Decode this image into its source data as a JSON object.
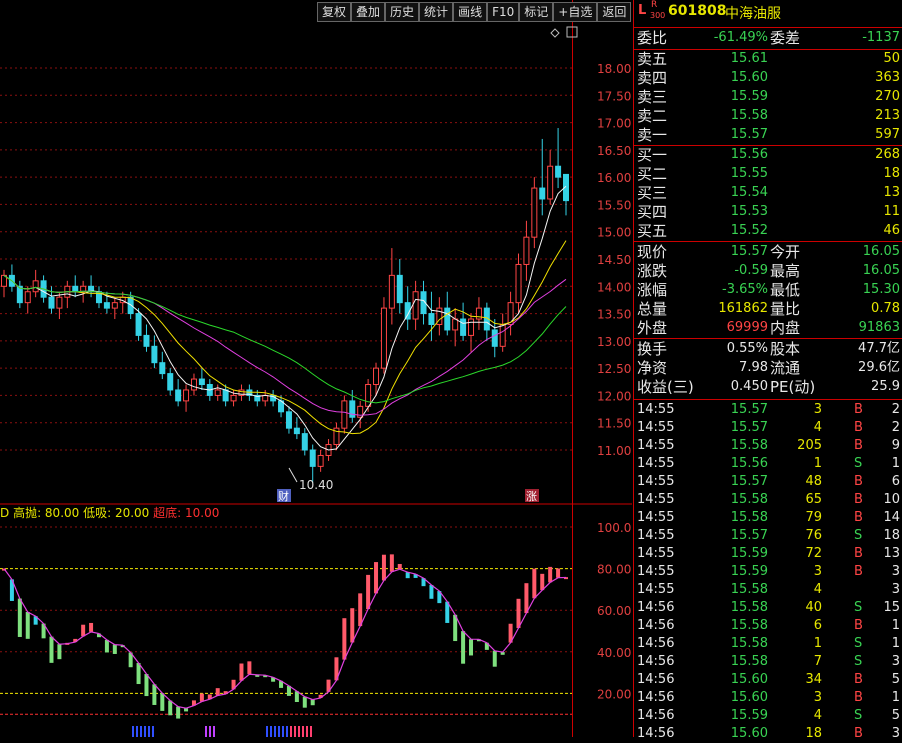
{
  "toolbar": [
    "复权",
    "叠加",
    "历史",
    "统计",
    "画线",
    "F10",
    "标记",
    "+自选",
    "返回"
  ],
  "stock": {
    "badge_l": "L",
    "badge_r": "R",
    "badge_num": "300",
    "code": "601808",
    "name": "中海油服"
  },
  "wei": {
    "bi_label": "委比",
    "bi_value": "-61.49%",
    "cha_label": "委差",
    "cha_value": "-1137"
  },
  "asks": [
    {
      "label": "卖五",
      "price": "15.61",
      "vol": "50"
    },
    {
      "label": "卖四",
      "price": "15.60",
      "vol": "363"
    },
    {
      "label": "卖三",
      "price": "15.59",
      "vol": "270"
    },
    {
      "label": "卖二",
      "price": "15.58",
      "vol": "213"
    },
    {
      "label": "卖一",
      "price": "15.57",
      "vol": "597"
    }
  ],
  "bids": [
    {
      "label": "买一",
      "price": "15.56",
      "vol": "268"
    },
    {
      "label": "买二",
      "price": "15.55",
      "vol": "18"
    },
    {
      "label": "买三",
      "price": "15.54",
      "vol": "13"
    },
    {
      "label": "买四",
      "price": "15.53",
      "vol": "11"
    },
    {
      "label": "买五",
      "price": "15.52",
      "vol": "46"
    }
  ],
  "quote": [
    {
      "l1": "现价",
      "v1": "15.57",
      "c1": "green",
      "l2": "今开",
      "v2": "16.05",
      "c2": "green"
    },
    {
      "l1": "涨跌",
      "v1": "-0.59",
      "c1": "green",
      "l2": "最高",
      "v2": "16.05",
      "c2": "green"
    },
    {
      "l1": "涨幅",
      "v1": "-3.65%",
      "c1": "green",
      "l2": "最低",
      "v2": "15.30",
      "c2": "green"
    },
    {
      "l1": "总量",
      "v1": "161862",
      "c1": "yellow",
      "l2": "量比",
      "v2": "0.78",
      "c2": "yellow"
    },
    {
      "l1": "外盘",
      "v1": "69999",
      "c1": "red",
      "l2": "内盘",
      "v2": "91863",
      "c2": "green"
    }
  ],
  "info": [
    {
      "l1": "换手",
      "v1": "0.55%",
      "l2": "股本",
      "v2": "47.7亿"
    },
    {
      "l1": "净资",
      "v1": "7.98",
      "l2": "流通",
      "v2": "29.6亿"
    },
    {
      "l1": "收益(三)",
      "v1": "0.450",
      "l2": "PE(动)",
      "v2": "25.9"
    }
  ],
  "ticks": [
    {
      "t": "14:55",
      "p": "15.57",
      "v": "3",
      "d": "B",
      "n": "2"
    },
    {
      "t": "14:55",
      "p": "15.57",
      "v": "4",
      "d": "B",
      "n": "2"
    },
    {
      "t": "14:55",
      "p": "15.58",
      "v": "205",
      "d": "B",
      "n": "9"
    },
    {
      "t": "14:55",
      "p": "15.56",
      "v": "1",
      "d": "S",
      "n": "1"
    },
    {
      "t": "14:55",
      "p": "15.57",
      "v": "48",
      "d": "B",
      "n": "6"
    },
    {
      "t": "14:55",
      "p": "15.58",
      "v": "65",
      "d": "B",
      "n": "10"
    },
    {
      "t": "14:55",
      "p": "15.58",
      "v": "79",
      "d": "B",
      "n": "14"
    },
    {
      "t": "14:55",
      "p": "15.57",
      "v": "76",
      "d": "S",
      "n": "18"
    },
    {
      "t": "14:55",
      "p": "15.59",
      "v": "72",
      "d": "B",
      "n": "13"
    },
    {
      "t": "14:55",
      "p": "15.59",
      "v": "3",
      "d": "B",
      "n": "3"
    },
    {
      "t": "14:55",
      "p": "15.58",
      "v": "4",
      "d": "",
      "n": "3"
    },
    {
      "t": "14:56",
      "p": "15.58",
      "v": "40",
      "d": "S",
      "n": "15"
    },
    {
      "t": "14:56",
      "p": "15.58",
      "v": "6",
      "d": "B",
      "n": "1"
    },
    {
      "t": "14:56",
      "p": "15.58",
      "v": "1",
      "d": "S",
      "n": "1"
    },
    {
      "t": "14:56",
      "p": "15.58",
      "v": "7",
      "d": "S",
      "n": "3"
    },
    {
      "t": "14:56",
      "p": "15.60",
      "v": "34",
      "d": "B",
      "n": "5"
    },
    {
      "t": "14:56",
      "p": "15.60",
      "v": "3",
      "d": "B",
      "n": "1"
    },
    {
      "t": "14:56",
      "p": "15.59",
      "v": "4",
      "d": "S",
      "n": "5"
    },
    {
      "t": "14:56",
      "p": "15.60",
      "v": "18",
      "d": "B",
      "n": "3"
    }
  ],
  "indicator": {
    "lead": "D",
    "gao_label": "高抛:",
    "gao": "80.00",
    "di_label": "低吸:",
    "di": "20.00",
    "chao_label": "超底:",
    "chao": "10.00"
  },
  "chart_markers": {
    "low_label": "10.40",
    "cai": "财",
    "zhang": "涨"
  },
  "colors": {
    "up": "#ff4545",
    "down": "#35d2e6",
    "ma5": "#f5f5f5",
    "ma10": "#f0e000",
    "ma20": "#e040e0",
    "ma60": "#2bd82b",
    "grid": "#8a1010"
  },
  "chart_data": [
    {
      "type": "candlestick",
      "y_ticks": [
        18.0,
        17.5,
        17.0,
        16.5,
        16.0,
        15.5,
        15.0,
        14.5,
        14.0,
        13.5,
        13.0,
        12.5,
        12.0,
        11.5,
        11.0
      ],
      "ylim": [
        10.2,
        18.3
      ],
      "candles": [
        [
          14.0,
          14.3,
          13.8,
          14.2
        ],
        [
          14.2,
          14.4,
          13.9,
          14.0
        ],
        [
          14.0,
          14.1,
          13.6,
          13.7
        ],
        [
          13.7,
          14.0,
          13.5,
          13.9
        ],
        [
          13.9,
          14.3,
          13.8,
          14.1
        ],
        [
          14.1,
          14.2,
          13.7,
          13.8
        ],
        [
          13.8,
          14.0,
          13.5,
          13.6
        ],
        [
          13.6,
          13.9,
          13.4,
          13.8
        ],
        [
          13.8,
          14.1,
          13.6,
          14.0
        ],
        [
          14.0,
          14.2,
          13.8,
          13.9
        ],
        [
          13.9,
          14.1,
          13.7,
          14.0
        ],
        [
          14.0,
          14.2,
          13.8,
          13.9
        ],
        [
          13.9,
          14.0,
          13.6,
          13.7
        ],
        [
          13.7,
          13.9,
          13.5,
          13.6
        ],
        [
          13.6,
          13.8,
          13.4,
          13.7
        ],
        [
          13.7,
          13.9,
          13.5,
          13.8
        ],
        [
          13.8,
          13.9,
          13.4,
          13.5
        ],
        [
          13.5,
          13.6,
          13.0,
          13.1
        ],
        [
          13.1,
          13.3,
          12.8,
          12.9
        ],
        [
          12.9,
          13.1,
          12.5,
          12.6
        ],
        [
          12.6,
          12.8,
          12.3,
          12.4
        ],
        [
          12.4,
          12.5,
          12.0,
          12.1
        ],
        [
          12.1,
          12.3,
          11.8,
          11.9
        ],
        [
          11.9,
          12.2,
          11.7,
          12.1
        ],
        [
          12.1,
          12.4,
          12.0,
          12.3
        ],
        [
          12.3,
          12.5,
          12.1,
          12.2
        ],
        [
          12.2,
          12.3,
          11.9,
          12.0
        ],
        [
          12.0,
          12.2,
          11.9,
          12.1
        ],
        [
          12.1,
          12.2,
          11.8,
          11.9
        ],
        [
          11.9,
          12.1,
          11.8,
          12.0
        ],
        [
          12.0,
          12.2,
          11.9,
          12.1
        ],
        [
          12.1,
          12.2,
          11.9,
          12.0
        ],
        [
          12.0,
          12.1,
          11.8,
          11.9
        ],
        [
          11.9,
          12.1,
          11.8,
          12.0
        ],
        [
          12.0,
          12.1,
          11.8,
          11.9
        ],
        [
          11.9,
          12.0,
          11.6,
          11.7
        ],
        [
          11.7,
          11.8,
          11.3,
          11.4
        ],
        [
          11.4,
          11.6,
          11.2,
          11.3
        ],
        [
          11.3,
          11.4,
          10.9,
          11.0
        ],
        [
          11.0,
          11.1,
          10.4,
          10.7
        ],
        [
          10.7,
          11.0,
          10.6,
          10.9
        ],
        [
          10.9,
          11.2,
          10.8,
          11.1
        ],
        [
          11.1,
          11.5,
          11.0,
          11.4
        ],
        [
          11.4,
          12.0,
          11.3,
          11.9
        ],
        [
          11.9,
          12.1,
          11.5,
          11.6
        ],
        [
          11.6,
          11.9,
          11.4,
          11.8
        ],
        [
          11.8,
          12.3,
          11.7,
          12.2
        ],
        [
          12.2,
          12.6,
          12.0,
          12.5
        ],
        [
          12.5,
          13.8,
          12.4,
          13.6
        ],
        [
          13.6,
          14.7,
          13.3,
          14.2
        ],
        [
          14.2,
          14.5,
          13.5,
          13.7
        ],
        [
          13.7,
          14.0,
          13.2,
          13.4
        ],
        [
          13.4,
          14.1,
          13.2,
          13.9
        ],
        [
          13.9,
          14.1,
          13.3,
          13.5
        ],
        [
          13.5,
          13.9,
          13.0,
          13.3
        ],
        [
          13.3,
          13.8,
          13.1,
          13.6
        ],
        [
          13.6,
          13.9,
          13.1,
          13.2
        ],
        [
          13.2,
          13.6,
          12.9,
          13.4
        ],
        [
          13.4,
          13.7,
          13.0,
          13.1
        ],
        [
          13.1,
          13.5,
          12.8,
          13.4
        ],
        [
          13.4,
          13.8,
          13.2,
          13.6
        ],
        [
          13.6,
          13.7,
          13.0,
          13.2
        ],
        [
          13.2,
          13.4,
          12.7,
          12.9
        ],
        [
          12.9,
          13.5,
          12.8,
          13.3
        ],
        [
          13.3,
          13.9,
          13.1,
          13.7
        ],
        [
          13.7,
          14.6,
          13.5,
          14.4
        ],
        [
          14.4,
          15.2,
          14.1,
          14.9
        ],
        [
          14.9,
          16.0,
          14.7,
          15.8
        ],
        [
          15.8,
          16.7,
          15.3,
          15.6
        ],
        [
          15.6,
          16.5,
          15.5,
          16.2
        ],
        [
          16.2,
          16.9,
          15.8,
          16.0
        ],
        [
          16.05,
          16.05,
          15.3,
          15.57
        ]
      ]
    },
    {
      "type": "line",
      "y_ticks": [
        100.0,
        80.0,
        60.0,
        40.0,
        20.0
      ],
      "ylim": [
        0,
        105
      ],
      "levels": [
        80,
        20,
        10
      ],
      "series": []
    }
  ]
}
